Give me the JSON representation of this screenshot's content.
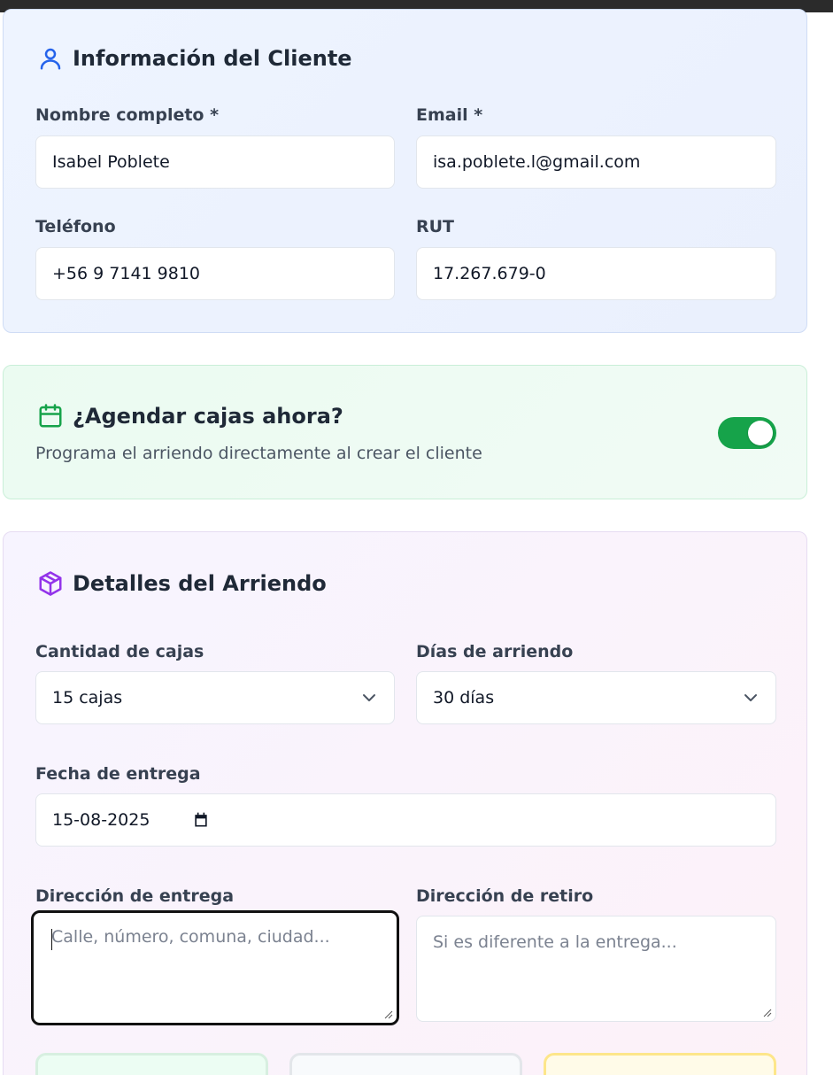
{
  "client_section": {
    "title": "Información del Cliente",
    "fields": {
      "name": {
        "label": "Nombre completo *",
        "value": "Isabel Poblete"
      },
      "email": {
        "label": "Email *",
        "value": "isa.poblete.l@gmail.com"
      },
      "phone": {
        "label": "Teléfono",
        "value": "+56 9 7141 9810"
      },
      "rut": {
        "label": "RUT",
        "value": "17.267.679-0"
      }
    }
  },
  "schedule_section": {
    "title": "¿Agendar cajas ahora?",
    "description": "Programa el arriendo directamente al crear el cliente",
    "toggle_on": true
  },
  "rental_section": {
    "title": "Detalles del Arriendo",
    "box_quantity": {
      "label": "Cantidad de cajas",
      "value": "15 cajas"
    },
    "rental_days": {
      "label": "Días de arriendo",
      "value": "30 días"
    },
    "delivery_date": {
      "label": "Fecha de entrega",
      "value": "15-08-2025"
    },
    "delivery_address": {
      "label": "Dirección de entrega",
      "placeholder": "Calle, número, comuna, ciudad..."
    },
    "pickup_address": {
      "label": "Dirección de retiro",
      "placeholder": "Si es diferente a la entrega..."
    }
  },
  "colors": {
    "toggle_on": "#16a34a",
    "client_icon": "#2563eb",
    "schedule_icon": "#16a34a",
    "rental_icon": "#9333ea"
  },
  "icons": {
    "client": "user-icon",
    "schedule": "calendar-icon",
    "rental": "package-icon",
    "select": "chevron-down-icon",
    "date": "calendar-icon"
  }
}
